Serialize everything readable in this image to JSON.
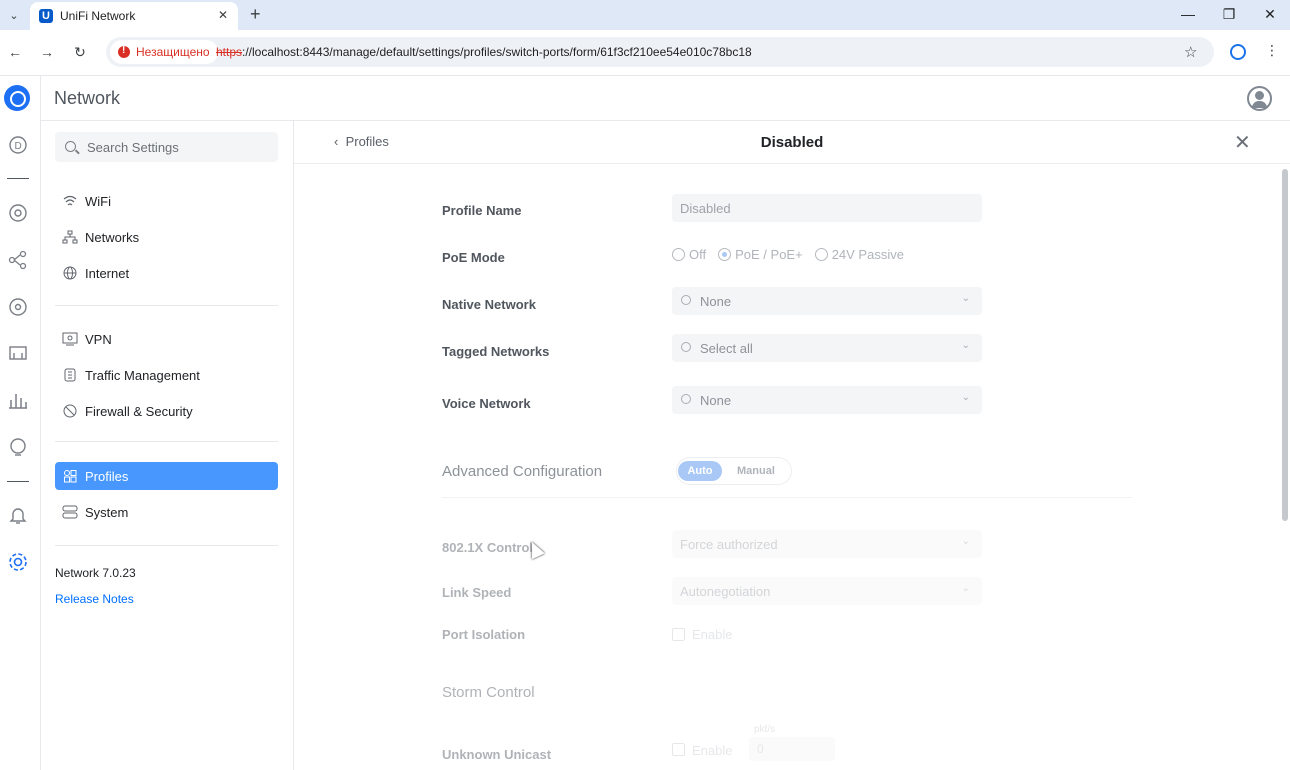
{
  "browser": {
    "tab_title": "UniFi Network",
    "tab_favicon_letter": "U",
    "security_label": "Незащищено",
    "url_protocol": "https",
    "url_rest": "://localhost:8443/manage/default/settings/profiles/switch-ports/form/61f3cf210ee54e010c78bc18"
  },
  "app": {
    "header_title": "Network"
  },
  "sidebar": {
    "search_placeholder": "Search Settings",
    "items": [
      {
        "label": "WiFi",
        "icon": "wifi-icon"
      },
      {
        "label": "Networks",
        "icon": "networks-icon"
      },
      {
        "label": "Internet",
        "icon": "globe-icon"
      },
      {
        "label": "VPN",
        "icon": "vpn-icon"
      },
      {
        "label": "Traffic Management",
        "icon": "traffic-icon"
      },
      {
        "label": "Firewall & Security",
        "icon": "shield-icon"
      },
      {
        "label": "Profiles",
        "icon": "profiles-icon",
        "active": true
      },
      {
        "label": "System",
        "icon": "system-icon"
      }
    ],
    "version": "Network 7.0.23",
    "release_notes": "Release Notes"
  },
  "panel": {
    "back_label": "Profiles",
    "title": "Disabled",
    "fields": {
      "profile_name_label": "Profile Name",
      "profile_name_value": "Disabled",
      "poe_mode_label": "PoE Mode",
      "poe_options": [
        "Off",
        "PoE / PoE+",
        "24V Passive"
      ],
      "poe_selected": "PoE / PoE+",
      "native_network_label": "Native Network",
      "native_network_value": "None",
      "tagged_networks_label": "Tagged Networks",
      "tagged_networks_value": "Select all",
      "voice_network_label": "Voice Network",
      "voice_network_value": "None"
    },
    "advanced": {
      "title": "Advanced Configuration",
      "mode_auto": "Auto",
      "mode_manual": "Manual",
      "mode_selected": "Auto",
      "dot1x_label": "802.1X Control",
      "dot1x_value": "Force authorized",
      "link_speed_label": "Link Speed",
      "link_speed_value": "Autonegotiation",
      "port_isolation_label": "Port Isolation",
      "port_isolation_option": "Enable",
      "storm_control_title": "Storm Control",
      "unknown_unicast_label": "Unknown Unicast",
      "unknown_unicast_option": "Enable",
      "unknown_unicast_unit": "pkt/s",
      "unknown_unicast_value": "0"
    }
  },
  "colors": {
    "accent": "#4797ff",
    "warning": "#d93025",
    "link": "#006fff"
  }
}
